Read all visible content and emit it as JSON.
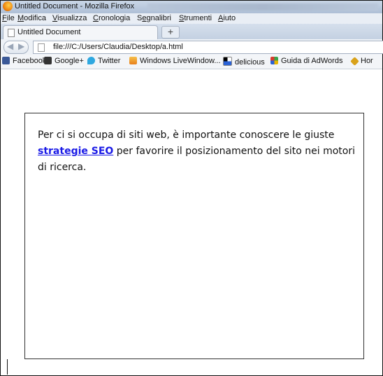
{
  "window": {
    "title": "Untitled Document - Mozilla Firefox"
  },
  "menubar": {
    "items": [
      {
        "accel": "F",
        "rest": "ile"
      },
      {
        "accel": "M",
        "rest": "odifica"
      },
      {
        "accel": "V",
        "rest": "isualizza"
      },
      {
        "accel": "C",
        "rest": "ronologia"
      },
      {
        "pre": "S",
        "accel": "e",
        "rest": "gnalibri"
      },
      {
        "accel": "S",
        "rest": "trumenti"
      },
      {
        "accel": "A",
        "rest": "iuto"
      }
    ]
  },
  "tab": {
    "title": "Untitled Document",
    "new_tab": "+"
  },
  "nav": {
    "back": "◀",
    "forward": "▶",
    "url": "file:///C:/Users/Claudia/Desktop/a.html"
  },
  "bookmarks": [
    {
      "label": "Facebook",
      "icon": "facebook-icon",
      "color": "#3b5998"
    },
    {
      "label": "Google+",
      "icon": "googleplus-icon",
      "color": "#333333"
    },
    {
      "label": "Twitter",
      "icon": "twitter-icon",
      "color": "#2fa8e0"
    },
    {
      "label": "Windows LiveWindow...",
      "icon": "mail-icon",
      "color": "#f0a020"
    },
    {
      "label": "delicious",
      "icon": "delicious-icon",
      "color": "#2a62d6"
    },
    {
      "label": "Guida di AdWords",
      "icon": "adwords-icon",
      "color": "#3aa34a"
    },
    {
      "label": "Hor",
      "icon": "bookmark-icon",
      "color": "#d9a21a"
    }
  ],
  "content": {
    "text_before": "Per ci si occupa di siti web, è importante conoscere le giuste ",
    "link_text": "strategie SEO",
    "text_after": " per favorire il posizionamento del sito nei motori di ricerca."
  }
}
